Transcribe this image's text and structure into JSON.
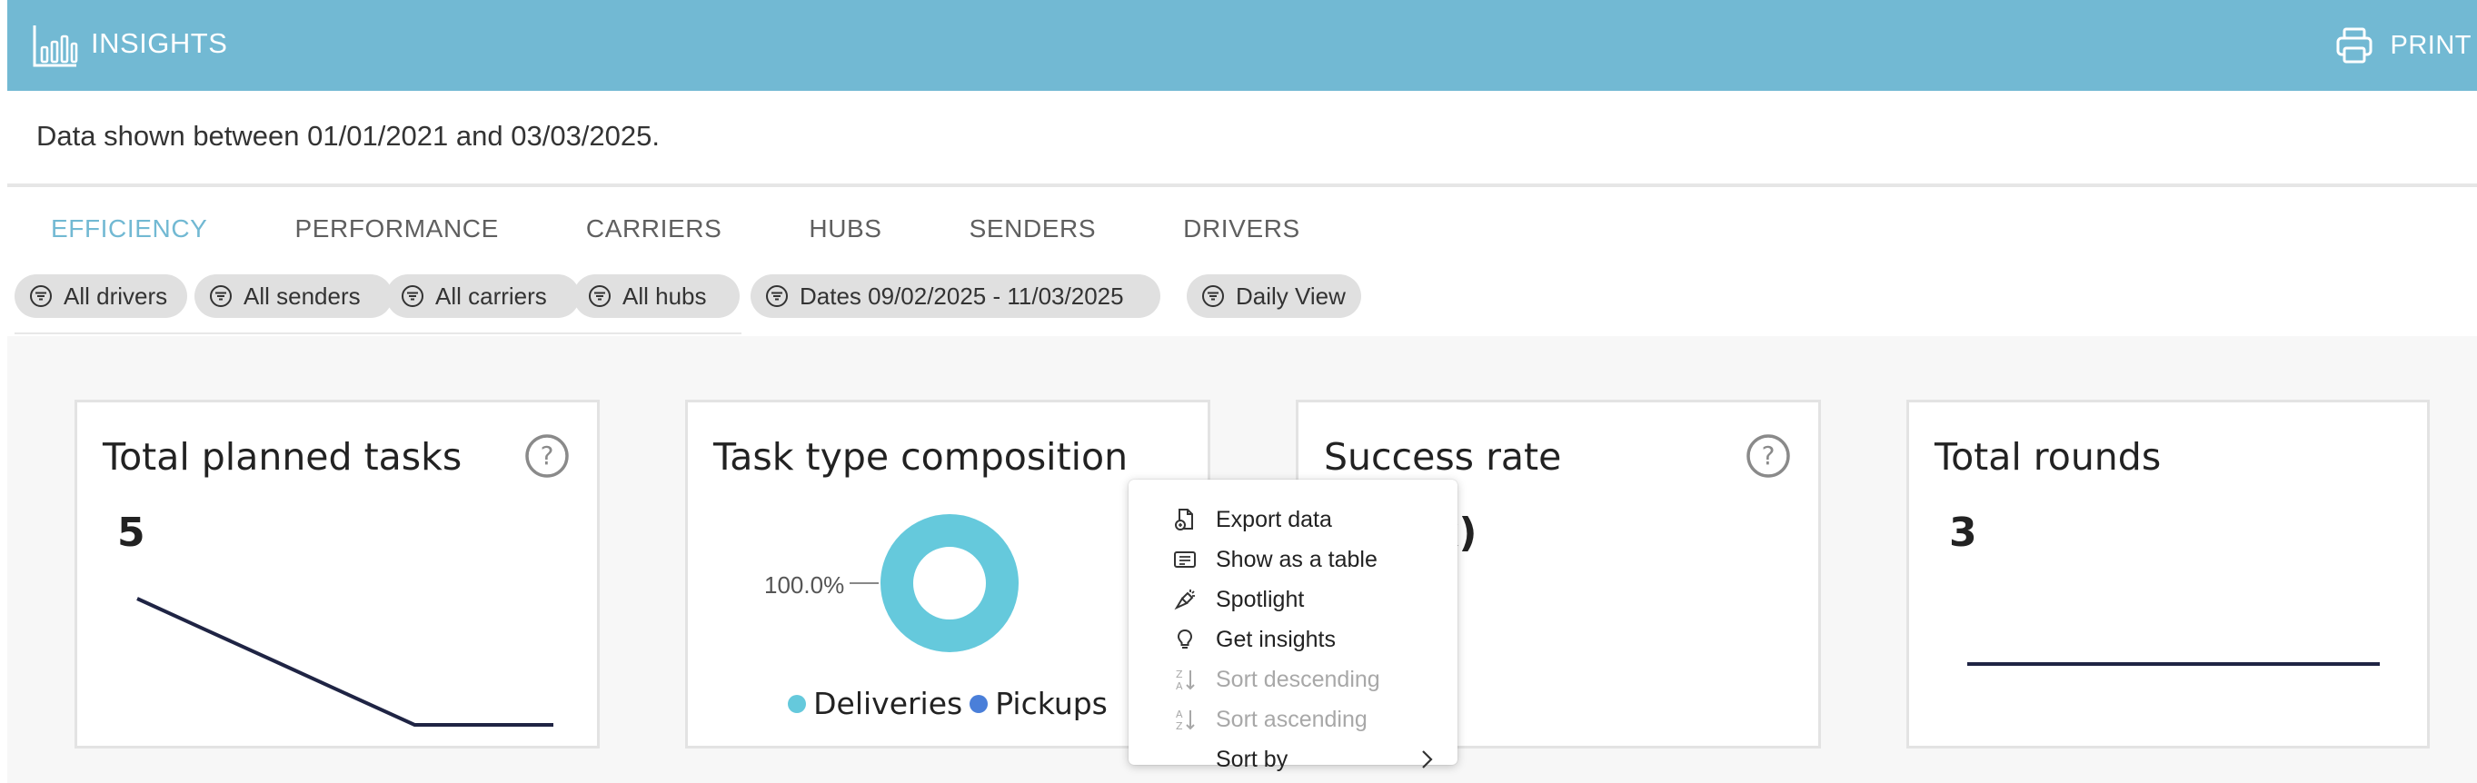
{
  "header": {
    "title": "INSIGHTS",
    "print_label": "PRINT",
    "bg_color": "#72b9d3",
    "logo_icon": "bar-chart-icon",
    "print_icon": "printer-icon"
  },
  "range_text": "Data shown between 01/01/2021 and 03/03/2025.",
  "tabs": [
    {
      "label": "EFFICIENCY",
      "active": true
    },
    {
      "label": "PERFORMANCE",
      "active": false
    },
    {
      "label": "CARRIERS",
      "active": false
    },
    {
      "label": "HUBS",
      "active": false
    },
    {
      "label": "SENDERS",
      "active": false
    },
    {
      "label": "DRIVERS",
      "active": false
    }
  ],
  "filters": [
    {
      "label": "All drivers",
      "icon": "filter-icon"
    },
    {
      "label": "All senders",
      "icon": "filter-icon"
    },
    {
      "label": "All carriers",
      "icon": "filter-icon"
    },
    {
      "label": "All hubs",
      "icon": "filter-icon"
    },
    {
      "label": "Dates 09/02/2025 - 11/03/2025",
      "icon": "filter-icon"
    },
    {
      "label": "Daily View",
      "icon": "filter-icon"
    }
  ],
  "cards": {
    "total_planned": {
      "title": "Total planned tasks",
      "value": "5",
      "trend": [
        5,
        4,
        3,
        2,
        1,
        1,
        1
      ]
    },
    "composition": {
      "title": "Task type composition",
      "slice_label": "100.0%",
      "slices": [
        {
          "name": "Deliveries",
          "share": 1.0,
          "color": "#65c9dc"
        },
        {
          "name": "Pickups",
          "share": 0.0,
          "color": "#4a7fd9"
        }
      ]
    },
    "success_rate": {
      "title": "Success rate",
      "value_visible": "x)"
    },
    "total_rounds": {
      "title": "Total rounds",
      "value": "3",
      "trend": [
        3,
        3,
        3,
        3
      ]
    }
  },
  "context_menu": {
    "items": [
      {
        "label": "Export data",
        "icon": "export-file-icon",
        "disabled": false
      },
      {
        "label": "Show as a table",
        "icon": "table-icon",
        "disabled": false
      },
      {
        "label": "Spotlight",
        "icon": "spotlight-icon",
        "disabled": false
      },
      {
        "label": "Get insights",
        "icon": "lightbulb-icon",
        "disabled": false
      },
      {
        "label": "Sort descending",
        "icon": "sort-za-icon",
        "disabled": true
      },
      {
        "label": "Sort ascending",
        "icon": "sort-az-icon",
        "disabled": true
      },
      {
        "label": "Sort by",
        "icon": "",
        "disabled": false,
        "submenu": true
      }
    ]
  }
}
